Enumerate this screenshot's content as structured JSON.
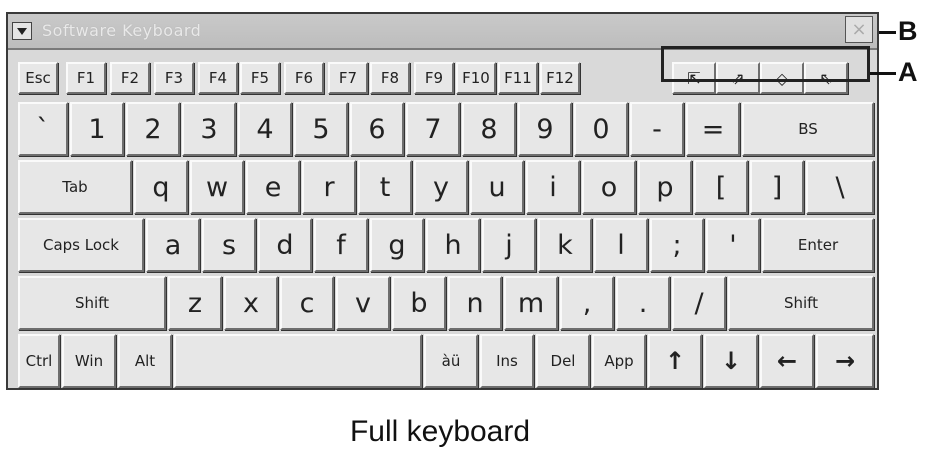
{
  "window": {
    "title": "Software Keyboard",
    "close_glyph": "×"
  },
  "callouts": {
    "a": "A",
    "b": "B"
  },
  "caption": "Full keyboard",
  "rows": {
    "function": [
      "Esc",
      "F1",
      "F2",
      "F3",
      "F4",
      "F5",
      "F6",
      "F7",
      "F8",
      "F9",
      "F10",
      "F11",
      "F12"
    ],
    "function_icons": [
      "⇱",
      "⇗",
      "◇",
      "⇖"
    ],
    "numbers": [
      "`",
      "1",
      "2",
      "3",
      "4",
      "5",
      "6",
      "7",
      "8",
      "9",
      "0",
      "-",
      "=",
      "BS"
    ],
    "top": [
      "Tab",
      "q",
      "w",
      "e",
      "r",
      "t",
      "y",
      "u",
      "i",
      "o",
      "p",
      "[",
      "]",
      "\\"
    ],
    "home": [
      "Caps Lock",
      "a",
      "s",
      "d",
      "f",
      "g",
      "h",
      "j",
      "k",
      "l",
      ";",
      "'",
      "Enter"
    ],
    "bottom": [
      "Shift",
      "z",
      "x",
      "c",
      "v",
      "b",
      "n",
      "m",
      ",",
      ".",
      "/",
      "Shift"
    ],
    "space": [
      "Ctrl",
      "Win",
      "Alt",
      "",
      "àü",
      "Ins",
      "Del",
      "App",
      "↑",
      "↓",
      "←",
      "→"
    ]
  }
}
